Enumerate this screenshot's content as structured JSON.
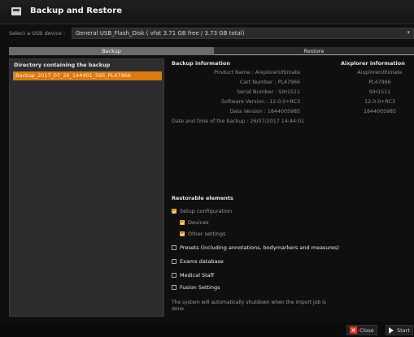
{
  "window": {
    "title": "Backup and Restore"
  },
  "usb": {
    "label": "Select a USB device :",
    "selected": "General USB_Flash_Disk ( vfat 3.71 GB free / 3.73 GB total)"
  },
  "tabs": {
    "backup": "Backup",
    "restore": "Restore"
  },
  "left_panel": {
    "header": "Directory containing the backup",
    "items": [
      "Backup_2017_07_26_144401_595_PL47966"
    ]
  },
  "backup_info": {
    "header": "Backup information",
    "rows": [
      {
        "label": "Product Name :",
        "value": "AixplorerUltimate"
      },
      {
        "label": "Cart Number :",
        "value": "PL47966"
      },
      {
        "label": "Serial Number :",
        "value": "SIH1511"
      },
      {
        "label": "Software Version :",
        "value": "12.0.0+RC3"
      },
      {
        "label": "Data Version :",
        "value": "1844005985"
      }
    ],
    "date_line": "Date and time of the backup : 26/07/2017 14:44:01"
  },
  "aixplorer_info": {
    "header": "Aixplorer information",
    "values": [
      "AixplorerUltimate",
      "PL47966",
      "SIH1511",
      "12.0.0+RC3",
      "1844005985"
    ]
  },
  "restorable": {
    "title": "Restorable elements",
    "setup": "Setup configuration",
    "devices": "Devices",
    "other": "Other settings",
    "presets": "Presets (including annotations, bodymarkers and measures)",
    "exams": "Exams database",
    "staff": "Medical Staff",
    "fusion": "Fusion Settings"
  },
  "note": "The system will automatically shutdown when the import job is done",
  "footer": {
    "close": "Close",
    "start": "Start"
  }
}
